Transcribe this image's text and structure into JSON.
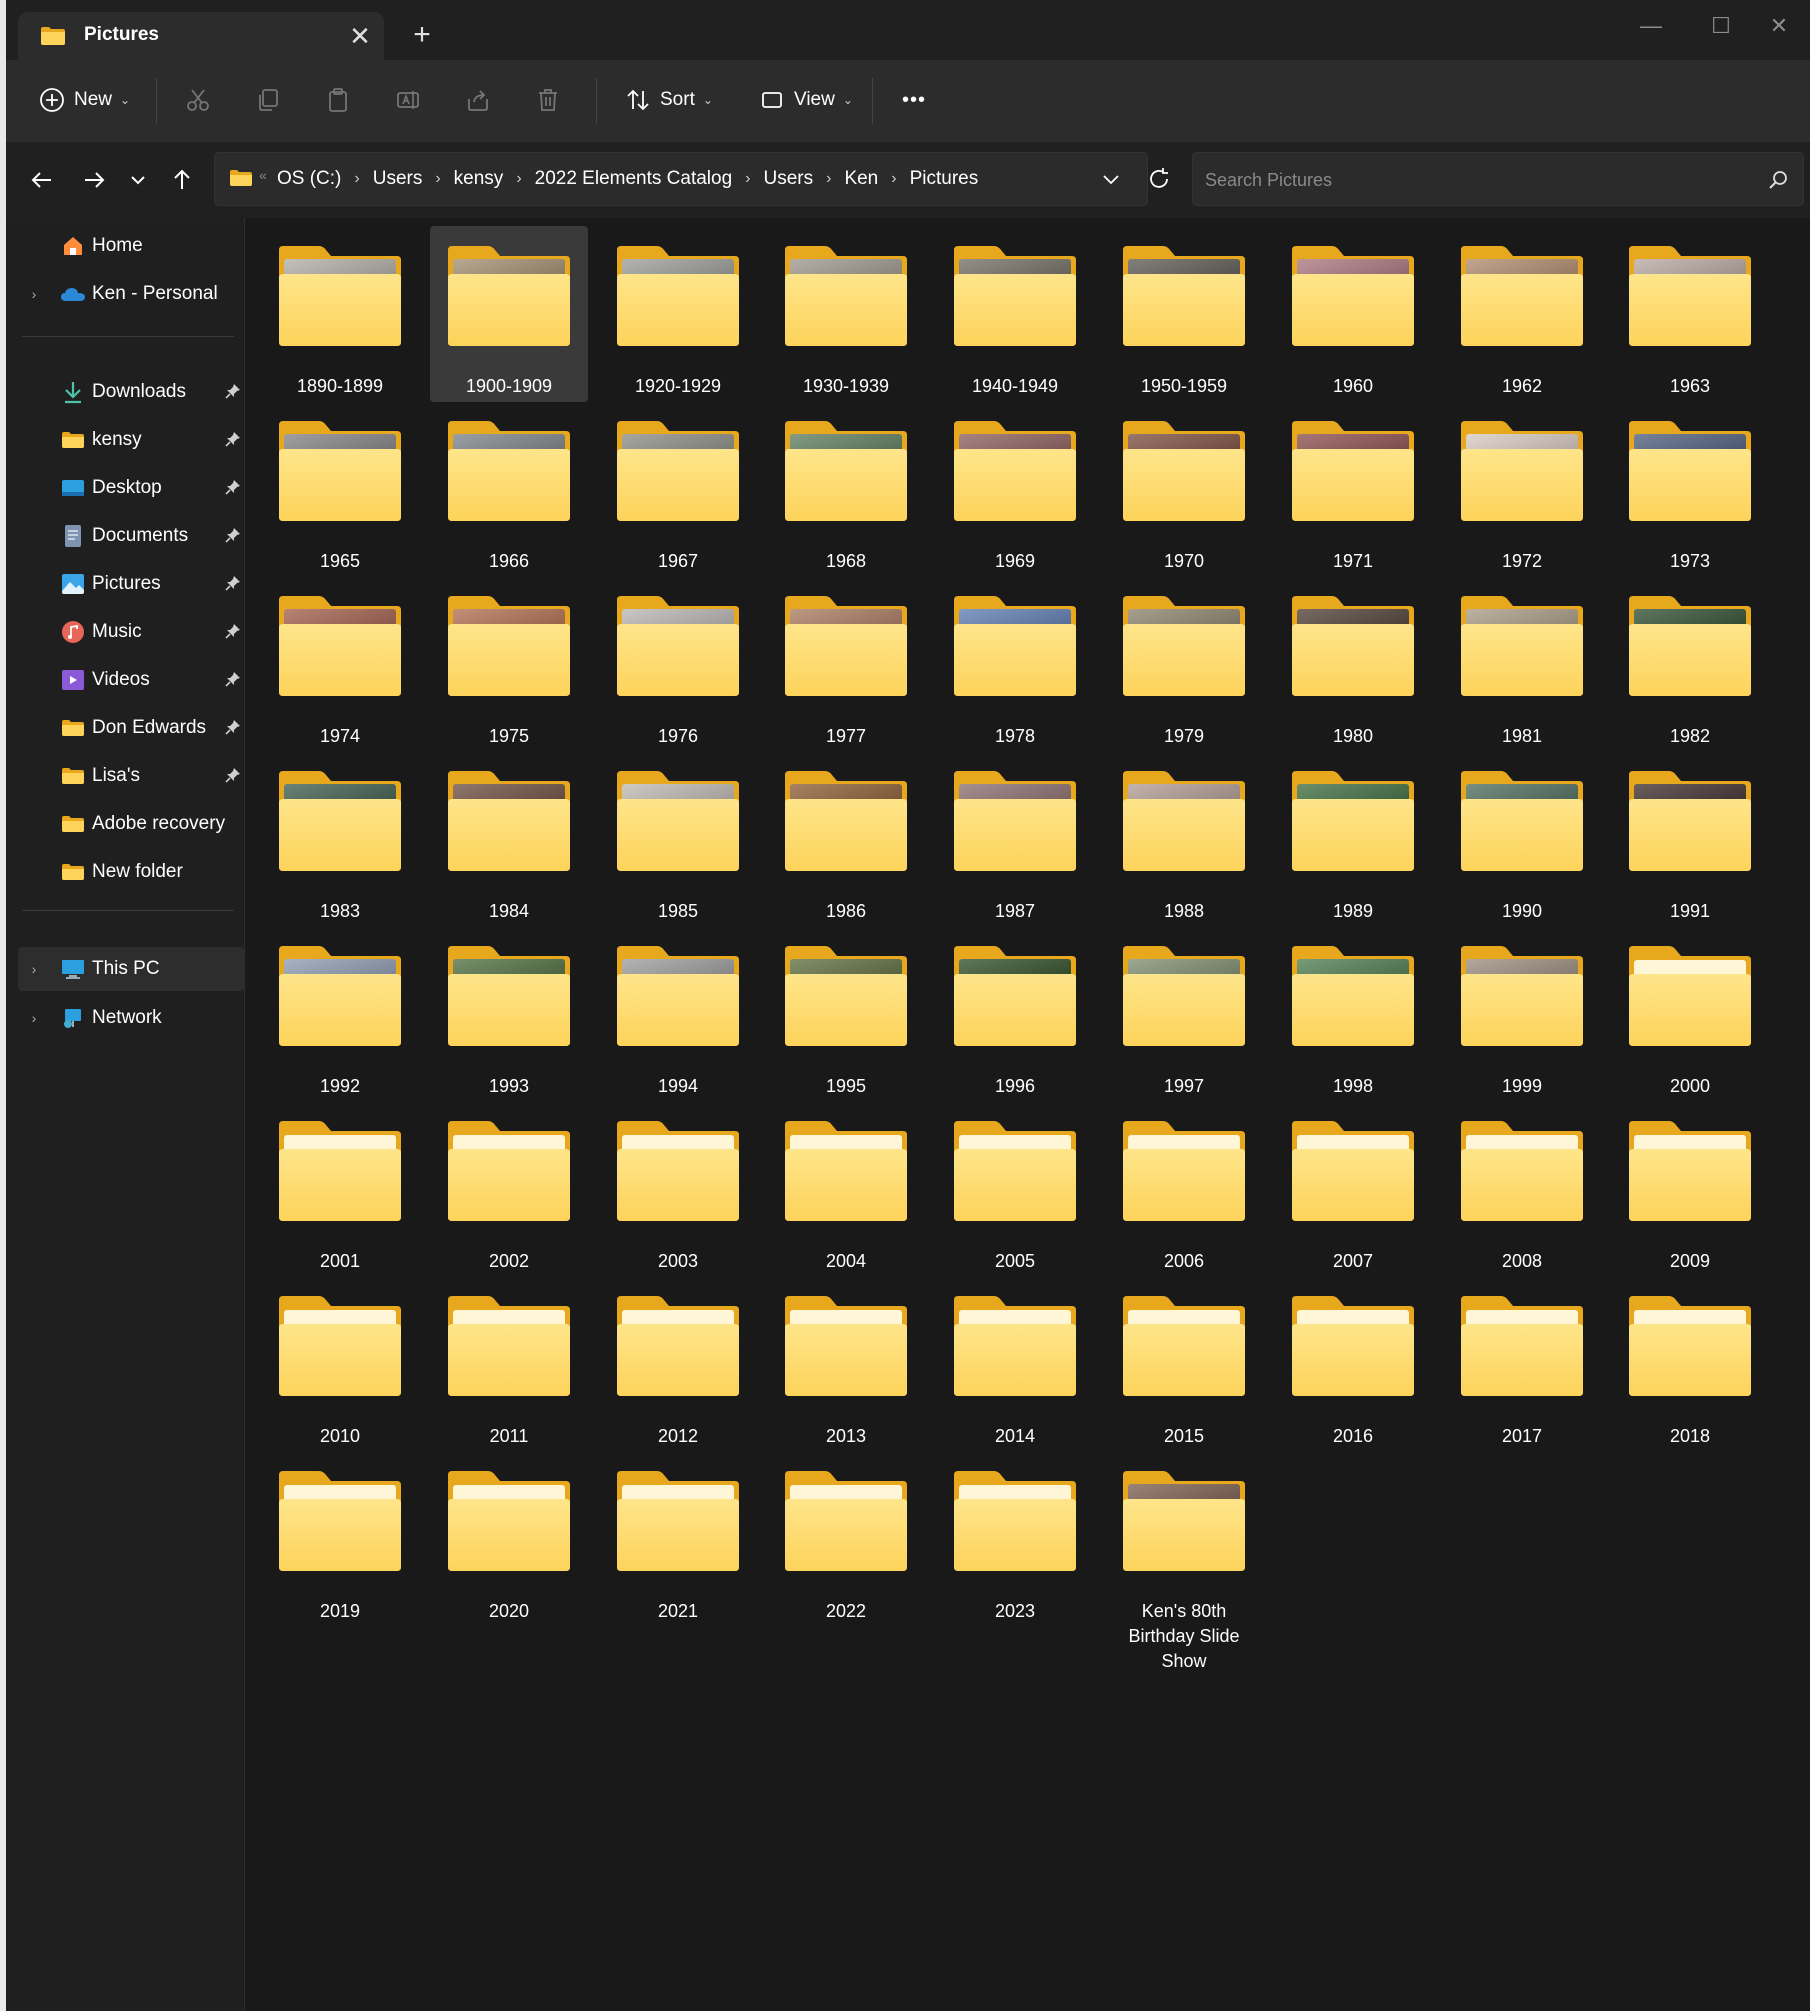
{
  "window": {
    "tab_title": "Pictures",
    "tab_close": "✕",
    "new_tab": "+",
    "minimize": "—",
    "maximize": "☐",
    "close": "✕"
  },
  "toolbar": {
    "new_label": "New",
    "sort_label": "Sort",
    "view_label": "View",
    "more_label": "•••"
  },
  "address": {
    "breadcrumbs": [
      "OS (C:)",
      "Users",
      "kensy",
      "2022 Elements Catalog",
      "Users",
      "Ken",
      "Pictures"
    ],
    "separator": "›",
    "overflow": "«"
  },
  "search": {
    "placeholder": "Search Pictures"
  },
  "sidebar": {
    "items": [
      {
        "label": "Home",
        "icon": "home-icon",
        "pinned": false,
        "expandable": false
      },
      {
        "label": "Ken - Personal",
        "icon": "onedrive-cloud-icon",
        "pinned": false,
        "expandable": true
      },
      {
        "label": "Downloads",
        "icon": "download-arrow-icon",
        "pinned": true,
        "expandable": false
      },
      {
        "label": "kensy",
        "icon": "folder-icon",
        "pinned": true,
        "expandable": false
      },
      {
        "label": "Desktop",
        "icon": "desktop-icon",
        "pinned": true,
        "expandable": false
      },
      {
        "label": "Documents",
        "icon": "documents-icon",
        "pinned": true,
        "expandable": false
      },
      {
        "label": "Pictures",
        "icon": "pictures-icon",
        "pinned": true,
        "expandable": false
      },
      {
        "label": "Music",
        "icon": "music-icon",
        "pinned": true,
        "expandable": false
      },
      {
        "label": "Videos",
        "icon": "videos-icon",
        "pinned": true,
        "expandable": false
      },
      {
        "label": "Don Edwards",
        "icon": "folder-icon",
        "pinned": true,
        "expandable": false
      },
      {
        "label": "Lisa's",
        "icon": "folder-icon",
        "pinned": true,
        "expandable": false
      },
      {
        "label": "Adobe recovery",
        "icon": "folder-icon",
        "pinned": false,
        "expandable": false
      },
      {
        "label": "New folder",
        "icon": "folder-icon",
        "pinned": false,
        "expandable": false
      },
      {
        "label": "This PC",
        "icon": "this-pc-icon",
        "pinned": false,
        "expandable": true,
        "selected": true
      },
      {
        "label": "Network",
        "icon": "network-icon",
        "pinned": false,
        "expandable": true
      }
    ]
  },
  "folders": [
    {
      "name": "1890-1899",
      "has_preview": true,
      "preview": "#b0aca4"
    },
    {
      "name": "1900-1909",
      "has_preview": true,
      "preview": "#a08b6a",
      "selected": true
    },
    {
      "name": "1920-1929",
      "has_preview": true,
      "preview": "#9a9a96"
    },
    {
      "name": "1930-1939",
      "has_preview": true,
      "preview": "#9c958a"
    },
    {
      "name": "1940-1949",
      "has_preview": true,
      "preview": "#6f6a60"
    },
    {
      "name": "1950-1959",
      "has_preview": true,
      "preview": "#5a564f"
    },
    {
      "name": "1960",
      "has_preview": true,
      "preview": "#a8727a"
    },
    {
      "name": "1962",
      "has_preview": true,
      "preview": "#b08868"
    },
    {
      "name": "1963",
      "has_preview": true,
      "preview": "#b8a6a0"
    },
    {
      "name": "1965",
      "has_preview": true,
      "preview": "#808080"
    },
    {
      "name": "1966",
      "has_preview": true,
      "preview": "#7a8086"
    },
    {
      "name": "1967",
      "has_preview": true,
      "preview": "#8a8a82"
    },
    {
      "name": "1968",
      "has_preview": true,
      "preview": "#5a7a5a"
    },
    {
      "name": "1969",
      "has_preview": true,
      "preview": "#8a5a58"
    },
    {
      "name": "1970",
      "has_preview": true,
      "preview": "#7a4a3a"
    },
    {
      "name": "1971",
      "has_preview": true,
      "preview": "#8a4a4a"
    },
    {
      "name": "1972",
      "has_preview": true,
      "preview": "#d8c8c0"
    },
    {
      "name": "1973",
      "has_preview": true,
      "preview": "#4a5a7a"
    },
    {
      "name": "1974",
      "has_preview": true,
      "preview": "#a05a48"
    },
    {
      "name": "1975",
      "has_preview": true,
      "preview": "#b06a4a"
    },
    {
      "name": "1976",
      "has_preview": true,
      "preview": "#b8b4b0"
    },
    {
      "name": "1977",
      "has_preview": true,
      "preview": "#a8765a"
    },
    {
      "name": "1978",
      "has_preview": true,
      "preview": "#5a7ab0"
    },
    {
      "name": "1979",
      "has_preview": true,
      "preview": "#8a8068"
    },
    {
      "name": "1980",
      "has_preview": true,
      "preview": "#4a3a30"
    },
    {
      "name": "1981",
      "has_preview": true,
      "preview": "#a89880"
    },
    {
      "name": "1982",
      "has_preview": true,
      "preview": "#2a4a2a"
    },
    {
      "name": "1983",
      "has_preview": true,
      "preview": "#3a5a4a"
    },
    {
      "name": "1984",
      "has_preview": true,
      "preview": "#6a4a3a"
    },
    {
      "name": "1985",
      "has_preview": true,
      "preview": "#c0b8b0"
    },
    {
      "name": "1986",
      "has_preview": true,
      "preview": "#8a5a30"
    },
    {
      "name": "1987",
      "has_preview": true,
      "preview": "#8a6a6a"
    },
    {
      "name": "1988",
      "has_preview": true,
      "preview": "#b09a90"
    },
    {
      "name": "1989",
      "has_preview": true,
      "preview": "#3a6a3a"
    },
    {
      "name": "1990",
      "has_preview": true,
      "preview": "#4a6a5a"
    },
    {
      "name": "1991",
      "has_preview": true,
      "preview": "#3a2a28"
    },
    {
      "name": "1992",
      "has_preview": true,
      "preview": "#8a9ab0"
    },
    {
      "name": "1993",
      "has_preview": true,
      "preview": "#4a6a3a"
    },
    {
      "name": "1994",
      "has_preview": true,
      "preview": "#9a9a9a"
    },
    {
      "name": "1995",
      "has_preview": true,
      "preview": "#5a6a3a"
    },
    {
      "name": "1996",
      "has_preview": true,
      "preview": "#2a4a20"
    },
    {
      "name": "1997",
      "has_preview": true,
      "preview": "#7a8a6a"
    },
    {
      "name": "1998",
      "has_preview": true,
      "preview": "#4a7a4a"
    },
    {
      "name": "1999",
      "has_preview": true,
      "preview": "#9a8a7a"
    },
    {
      "name": "2000",
      "has_preview": false
    },
    {
      "name": "2001",
      "has_preview": false
    },
    {
      "name": "2002",
      "has_preview": false
    },
    {
      "name": "2003",
      "has_preview": false
    },
    {
      "name": "2004",
      "has_preview": false
    },
    {
      "name": "2005",
      "has_preview": false
    },
    {
      "name": "2006",
      "has_preview": false
    },
    {
      "name": "2007",
      "has_preview": false
    },
    {
      "name": "2008",
      "has_preview": false
    },
    {
      "name": "2009",
      "has_preview": false
    },
    {
      "name": "2010",
      "has_preview": false
    },
    {
      "name": "2011",
      "has_preview": false
    },
    {
      "name": "2012",
      "has_preview": false
    },
    {
      "name": "2013",
      "has_preview": false
    },
    {
      "name": "2014",
      "has_preview": false
    },
    {
      "name": "2015",
      "has_preview": false
    },
    {
      "name": "2016",
      "has_preview": false
    },
    {
      "name": "2017",
      "has_preview": false
    },
    {
      "name": "2018",
      "has_preview": false
    },
    {
      "name": "2019",
      "has_preview": false
    },
    {
      "name": "2020",
      "has_preview": false
    },
    {
      "name": "2021",
      "has_preview": false
    },
    {
      "name": "2022",
      "has_preview": false
    },
    {
      "name": "2023",
      "has_preview": false
    },
    {
      "name": "Ken's 80th Birthday Slide Show",
      "has_preview": true,
      "preview": "#7a5a4a"
    }
  ],
  "colors": {
    "folder_back": "#e8a81e",
    "folder_front": "#fdd35a",
    "folder_front_light": "#fee58a",
    "accent": "#4cc2ff"
  }
}
